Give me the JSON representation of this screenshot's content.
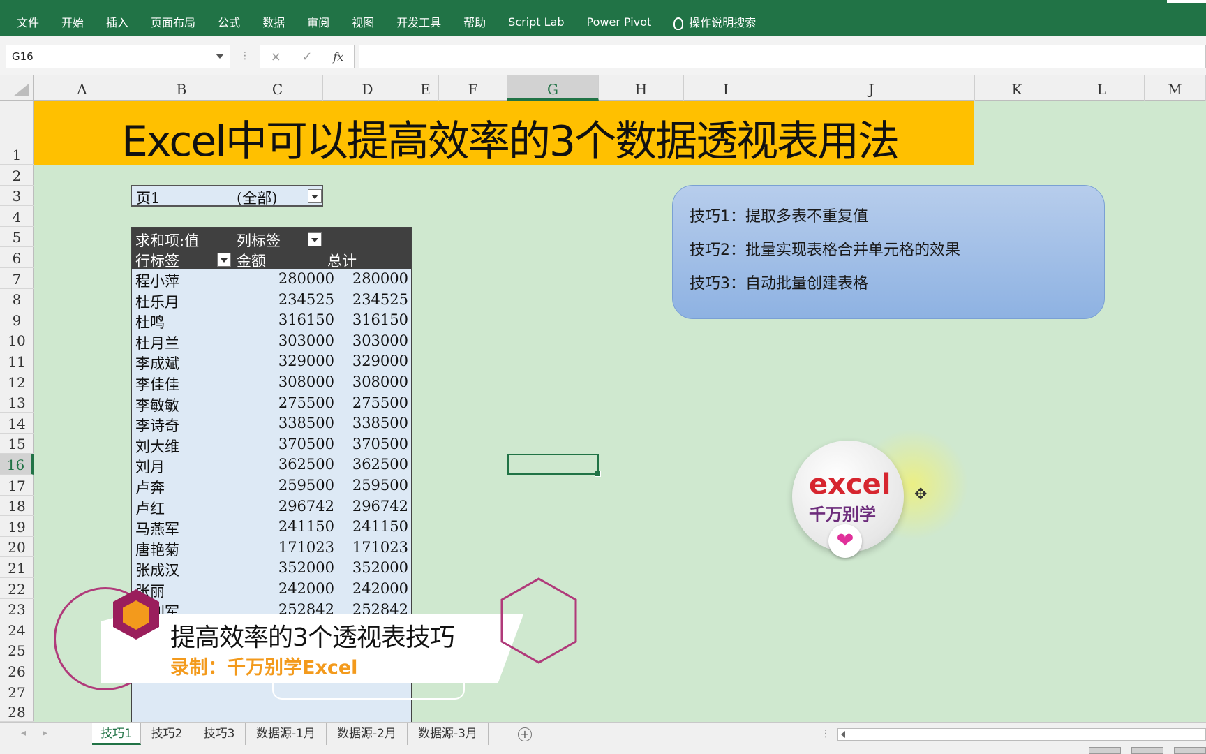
{
  "ribbon": {
    "tabs": [
      "文件",
      "开始",
      "插入",
      "页面布局",
      "公式",
      "数据",
      "审阅",
      "视图",
      "开发工具",
      "帮助",
      "Script Lab",
      "Power Pivot"
    ],
    "search_label": "操作说明搜索"
  },
  "formula_bar": {
    "name_box": "G16",
    "cancel_icon": "×",
    "enter_icon": "✓",
    "fx": "fx",
    "content": ""
  },
  "columns": [
    "A",
    "B",
    "C",
    "D",
    "E",
    "F",
    "G",
    "H",
    "I",
    "J",
    "K",
    "L",
    "M"
  ],
  "rows": [
    "1",
    "2",
    "3",
    "4",
    "5",
    "6",
    "7",
    "8",
    "9",
    "10",
    "11",
    "12",
    "13",
    "14",
    "15",
    "16",
    "17",
    "18",
    "19",
    "20",
    "21",
    "22",
    "23",
    "24",
    "25",
    "26",
    "27",
    "28"
  ],
  "selected_column": "G",
  "selected_row": "16",
  "title": "Excel中可以提高效率的3个数据透视表用法",
  "filter": {
    "label": "页1",
    "value": "(全部)"
  },
  "pivot": {
    "header_sum": "求和项:值",
    "header_collabel": "列标签",
    "header_rowlabel": "行标签",
    "header_amount": "金额",
    "header_total": "总计",
    "rows": [
      {
        "name": "程小萍",
        "amount": "280000",
        "total": "280000"
      },
      {
        "name": "杜乐月",
        "amount": "234525",
        "total": "234525"
      },
      {
        "name": "杜鸣",
        "amount": "316150",
        "total": "316150"
      },
      {
        "name": "杜月兰",
        "amount": "303000",
        "total": "303000"
      },
      {
        "name": "李成斌",
        "amount": "329000",
        "total": "329000"
      },
      {
        "name": "李佳佳",
        "amount": "308000",
        "total": "308000"
      },
      {
        "name": "李敏敏",
        "amount": "275500",
        "total": "275500"
      },
      {
        "name": "李诗奇",
        "amount": "338500",
        "total": "338500"
      },
      {
        "name": "刘大维",
        "amount": "370500",
        "total": "370500"
      },
      {
        "name": "刘月",
        "amount": "362500",
        "total": "362500"
      },
      {
        "name": "卢奔",
        "amount": "259500",
        "total": "259500"
      },
      {
        "name": "卢红",
        "amount": "296742",
        "total": "296742"
      },
      {
        "name": "马燕军",
        "amount": "241150",
        "total": "241150"
      },
      {
        "name": "唐艳菊",
        "amount": "171023",
        "total": "171023"
      },
      {
        "name": "张成汉",
        "amount": "352000",
        "total": "352000"
      },
      {
        "name": "张丽",
        "amount": "242000",
        "total": "242000"
      },
      {
        "name": "张利军",
        "amount": "252842",
        "total": "252842"
      }
    ]
  },
  "tips": [
    "技巧1：提取多表不重复值",
    "技巧2：批量实现表格合并单元格的效果",
    "技巧3：自动批量创建表格"
  ],
  "logo": {
    "line1": "excel",
    "line2": "千万别学",
    "heart": "❤"
  },
  "banner": {
    "title": "提高效率的3个透视表技巧",
    "subtitle": "录制：千万别学Excel"
  },
  "sheet_tabs": [
    "技巧1",
    "技巧2",
    "技巧3",
    "数据源-1月",
    "数据源-2月",
    "数据源-3月"
  ],
  "active_sheet": "技巧1",
  "add_sheet": "+",
  "colors": {
    "ribbon": "#217346",
    "title_banner": "#ffc000",
    "sheet_bg": "#cfe8cf",
    "pivot_header": "#404040",
    "pivot_body": "#dde9f5",
    "accent_orange": "#f39a1c",
    "accent_magenta": "#9a1e5c"
  }
}
